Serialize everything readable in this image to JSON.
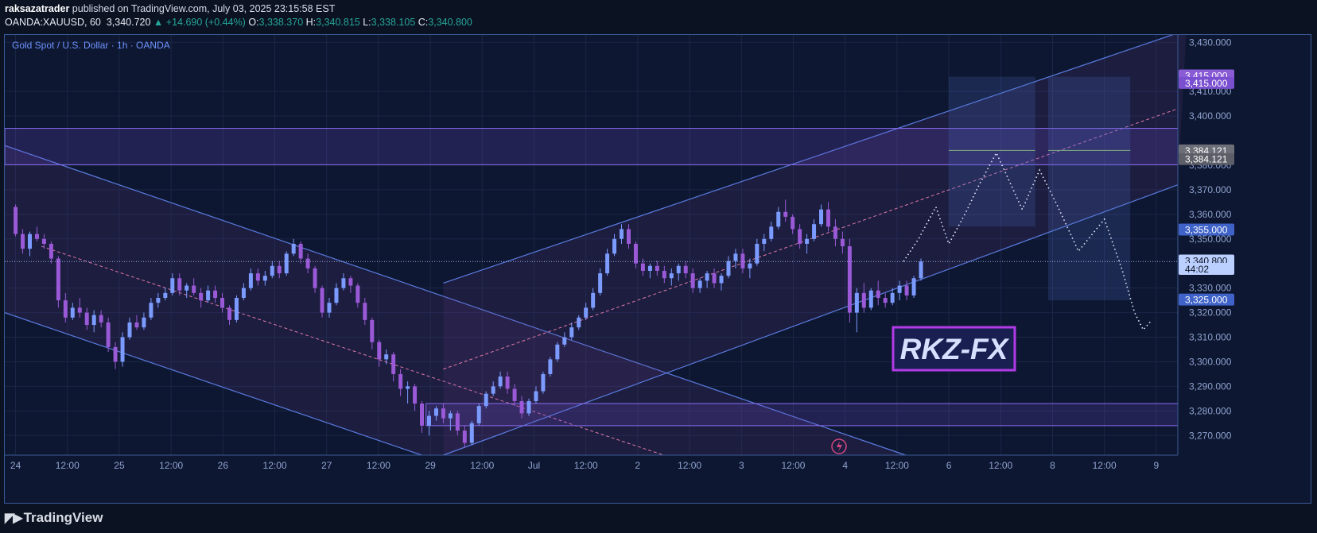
{
  "header": {
    "author": "raksazatrader",
    "published_text": "published on TradingView.com, July 03, 2025 23:15:58 EST",
    "symbol": "OANDA:XAUUSD, 60",
    "last": "3,340.720",
    "change": "▲ +14.690 (+0.44%)",
    "o_label": "O:",
    "o_value": "3,338.370",
    "h_label": "H:",
    "h_value": "3,340.815",
    "l_label": "L:",
    "l_value": "3,338.105",
    "c_label": "C:",
    "c_value": "3,340.800"
  },
  "footer": {
    "brand": "TradingView",
    "logo_icon": "tradingview-logo-icon"
  },
  "colors": {
    "bull": "#7b9bff",
    "bear": "#9a59d6",
    "bg": "#0e1731",
    "channel": "#5a7be0",
    "zone": "#6e4fc9",
    "accent": "#c23ef0"
  },
  "chart_data": {
    "type": "candlestick",
    "title": "Gold Spot / U.S. Dollar · 1h · OANDA",
    "ylim": [
      3262,
      3433
    ],
    "y_ticks": [
      "3,270.000",
      "3,280.000",
      "3,290.000",
      "3,300.000",
      "3,310.000",
      "3,320.000",
      "3,330.000",
      "3,350.000",
      "3,360.000",
      "3,370.000",
      "3,380.000",
      "3,400.000",
      "3,410.000",
      "3,430.000"
    ],
    "y_tick_values": [
      3270,
      3280,
      3290,
      3300,
      3310,
      3320,
      3330,
      3350,
      3360,
      3370,
      3380,
      3400,
      3410,
      3430
    ],
    "x_ticks": [
      "24",
      "12:00",
      "25",
      "12:00",
      "26",
      "12:00",
      "27",
      "12:00",
      "29",
      "12:00",
      "Jul",
      "12:00",
      "2",
      "12:00",
      "3",
      "12:00",
      "4",
      "12:00",
      "6",
      "12:00",
      "8",
      "12:00",
      "9"
    ],
    "x_tick_hours": [
      0,
      12,
      24,
      36,
      48,
      60,
      72,
      84,
      96,
      108,
      120,
      132,
      144,
      156,
      168,
      180,
      192,
      204,
      216,
      228,
      240,
      252,
      264
    ],
    "x_range_hours": [
      -2.5,
      269
    ],
    "price_labels": [
      {
        "text": "3,415.000",
        "value": 3416.5,
        "color": "#8a5cd6"
      },
      {
        "text": "3,415.000",
        "value": 3413.5,
        "color": "#7a4fd0"
      },
      {
        "text": "3,384.121",
        "value": 3386,
        "color": "#6d6f78"
      },
      {
        "text": "3,384.121",
        "value": 3382.5,
        "color": "#5d5f68"
      },
      {
        "text": "3,355.000",
        "value": 3353.8,
        "color": "#3f63c8"
      },
      {
        "text": "3,340.800",
        "value": 3341.2,
        "color": "#bcd0ff",
        "text_color": "#0b1222"
      },
      {
        "text": "44:02",
        "value": 3337.8,
        "color": "#bcd0ff",
        "text_color": "#0b1222"
      },
      {
        "text": "3,325.000",
        "value": 3325.3,
        "color": "#3f63c8"
      }
    ],
    "current_price": 3340.8,
    "candles": [
      [
        3363,
        3364,
        3351,
        3352
      ],
      [
        3352,
        3354,
        3344,
        3346
      ],
      [
        3346,
        3353,
        3343,
        3352
      ],
      [
        3352,
        3355,
        3349,
        3350
      ],
      [
        3350,
        3352,
        3346,
        3348
      ],
      [
        3348,
        3349,
        3340,
        3342
      ],
      [
        3342,
        3343,
        3322,
        3325
      ],
      [
        3325,
        3328,
        3316,
        3318
      ],
      [
        3318,
        3324,
        3317,
        3322
      ],
      [
        3322,
        3326,
        3318,
        3320
      ],
      [
        3320,
        3322,
        3313,
        3315
      ],
      [
        3315,
        3321,
        3312,
        3319
      ],
      [
        3319,
        3321,
        3314,
        3316
      ],
      [
        3316,
        3318,
        3304,
        3306
      ],
      [
        3306,
        3308,
        3297,
        3300
      ],
      [
        3300,
        3312,
        3298,
        3310
      ],
      [
        3310,
        3318,
        3309,
        3316
      ],
      [
        3316,
        3319,
        3313,
        3314
      ],
      [
        3314,
        3320,
        3313,
        3318
      ],
      [
        3318,
        3326,
        3317,
        3324
      ],
      [
        3324,
        3328,
        3322,
        3326
      ],
      [
        3326,
        3330,
        3325,
        3328
      ],
      [
        3328,
        3336,
        3327,
        3334
      ],
      [
        3334,
        3336,
        3327,
        3329
      ],
      [
        3329,
        3332,
        3326,
        3331
      ],
      [
        3331,
        3334,
        3327,
        3328
      ],
      [
        3328,
        3330,
        3322,
        3325
      ],
      [
        3325,
        3331,
        3324,
        3329
      ],
      [
        3329,
        3331,
        3324,
        3326
      ],
      [
        3326,
        3328,
        3320,
        3322
      ],
      [
        3322,
        3323,
        3315,
        3317
      ],
      [
        3317,
        3327,
        3316,
        3326
      ],
      [
        3326,
        3332,
        3325,
        3330
      ],
      [
        3330,
        3338,
        3329,
        3336
      ],
      [
        3336,
        3338,
        3331,
        3333
      ],
      [
        3333,
        3337,
        3331,
        3335
      ],
      [
        3335,
        3341,
        3334,
        3339
      ],
      [
        3339,
        3341,
        3334,
        3336
      ],
      [
        3336,
        3345,
        3335,
        3344
      ],
      [
        3344,
        3350,
        3343,
        3348
      ],
      [
        3348,
        3349,
        3340,
        3342
      ],
      [
        3342,
        3344,
        3336,
        3338
      ],
      [
        3338,
        3339,
        3328,
        3330
      ],
      [
        3330,
        3331,
        3318,
        3320
      ],
      [
        3320,
        3326,
        3318,
        3324
      ],
      [
        3324,
        3332,
        3323,
        3330
      ],
      [
        3330,
        3336,
        3329,
        3334
      ],
      [
        3334,
        3335,
        3328,
        3331
      ],
      [
        3331,
        3332,
        3322,
        3324
      ],
      [
        3324,
        3326,
        3315,
        3317
      ],
      [
        3317,
        3318,
        3305,
        3308
      ],
      [
        3308,
        3309,
        3298,
        3301
      ],
      [
        3301,
        3305,
        3299,
        3303
      ],
      [
        3303,
        3304,
        3292,
        3295
      ],
      [
        3295,
        3297,
        3286,
        3289
      ],
      [
        3289,
        3292,
        3283,
        3290
      ],
      [
        3290,
        3291,
        3280,
        3283
      ],
      [
        3283,
        3284,
        3271,
        3274
      ],
      [
        3274,
        3280,
        3270,
        3278
      ],
      [
        3278,
        3282,
        3276,
        3281
      ],
      [
        3281,
        3283,
        3275,
        3277
      ],
      [
        3277,
        3280,
        3272,
        3279
      ],
      [
        3279,
        3280,
        3270,
        3272
      ],
      [
        3272,
        3274,
        3265,
        3267
      ],
      [
        3267,
        3276,
        3266,
        3275
      ],
      [
        3275,
        3283,
        3274,
        3282
      ],
      [
        3282,
        3288,
        3281,
        3287
      ],
      [
        3287,
        3292,
        3286,
        3290
      ],
      [
        3290,
        3296,
        3289,
        3294
      ],
      [
        3294,
        3296,
        3287,
        3289
      ],
      [
        3289,
        3291,
        3282,
        3284
      ],
      [
        3284,
        3286,
        3277,
        3279
      ],
      [
        3279,
        3285,
        3278,
        3284
      ],
      [
        3284,
        3290,
        3283,
        3288
      ],
      [
        3288,
        3296,
        3287,
        3295
      ],
      [
        3295,
        3302,
        3294,
        3301
      ],
      [
        3301,
        3308,
        3300,
        3307
      ],
      [
        3307,
        3312,
        3306,
        3310
      ],
      [
        3310,
        3316,
        3309,
        3314
      ],
      [
        3314,
        3319,
        3313,
        3318
      ],
      [
        3318,
        3324,
        3317,
        3322
      ],
      [
        3322,
        3330,
        3321,
        3328
      ],
      [
        3328,
        3338,
        3327,
        3336
      ],
      [
        3336,
        3346,
        3335,
        3344
      ],
      [
        3344,
        3352,
        3343,
        3350
      ],
      [
        3350,
        3356,
        3348,
        3354
      ],
      [
        3354,
        3356,
        3346,
        3348
      ],
      [
        3348,
        3349,
        3338,
        3340
      ],
      [
        3340,
        3342,
        3335,
        3337
      ],
      [
        3337,
        3340,
        3334,
        3339
      ],
      [
        3339,
        3341,
        3335,
        3337
      ],
      [
        3337,
        3339,
        3332,
        3334
      ],
      [
        3334,
        3338,
        3331,
        3336
      ],
      [
        3336,
        3340,
        3333,
        3339
      ],
      [
        3339,
        3341,
        3334,
        3336
      ],
      [
        3336,
        3338,
        3328,
        3330
      ],
      [
        3330,
        3334,
        3328,
        3333
      ],
      [
        3333,
        3337,
        3330,
        3336
      ],
      [
        3336,
        3338,
        3330,
        3332
      ],
      [
        3332,
        3336,
        3329,
        3335
      ],
      [
        3335,
        3343,
        3334,
        3341
      ],
      [
        3341,
        3346,
        3338,
        3344
      ],
      [
        3344,
        3346,
        3336,
        3338
      ],
      [
        3338,
        3342,
        3334,
        3340
      ],
      [
        3340,
        3350,
        3339,
        3348
      ],
      [
        3348,
        3352,
        3345,
        3350
      ],
      [
        3350,
        3357,
        3349,
        3355
      ],
      [
        3355,
        3363,
        3354,
        3361
      ],
      [
        3361,
        3366,
        3357,
        3359
      ],
      [
        3359,
        3360,
        3352,
        3354
      ],
      [
        3354,
        3356,
        3346,
        3348
      ],
      [
        3348,
        3352,
        3344,
        3350
      ],
      [
        3350,
        3358,
        3349,
        3356
      ],
      [
        3356,
        3364,
        3355,
        3362
      ],
      [
        3362,
        3365,
        3353,
        3355
      ],
      [
        3355,
        3358,
        3347,
        3350
      ],
      [
        3350,
        3353,
        3344,
        3347
      ],
      [
        3347,
        3350,
        3316,
        3320
      ],
      [
        3320,
        3330,
        3312,
        3328
      ],
      [
        3328,
        3332,
        3320,
        3322
      ],
      [
        3322,
        3330,
        3321,
        3329
      ],
      [
        3329,
        3333,
        3323,
        3326
      ],
      [
        3326,
        3328,
        3322,
        3324
      ],
      [
        3324,
        3330,
        3323,
        3328
      ],
      [
        3328,
        3333,
        3325,
        3331
      ],
      [
        3331,
        3333,
        3325,
        3327
      ],
      [
        3327,
        3335,
        3326,
        3334
      ],
      [
        3334,
        3342,
        3333,
        3340.8
      ]
    ],
    "projection_path": [
      [
        205.5,
        3340.8
      ],
      [
        209,
        3350
      ],
      [
        213,
        3363
      ],
      [
        216,
        3348
      ],
      [
        220,
        3361
      ],
      [
        223,
        3372
      ],
      [
        227,
        3385
      ],
      [
        233,
        3362
      ],
      [
        237,
        3378
      ],
      [
        241,
        3364
      ],
      [
        246,
        3345
      ],
      [
        252,
        3358
      ],
      [
        256,
        3338
      ],
      [
        259,
        3320
      ],
      [
        261,
        3313
      ],
      [
        263,
        3317
      ]
    ],
    "zones": [
      {
        "name": "resistance-zone",
        "from": 3380.2,
        "to": 3395
      },
      {
        "name": "support-zone",
        "from": 3274,
        "to": 3283
      }
    ],
    "boxes": [
      {
        "name": "range-box-left",
        "t0": 216,
        "t1": 236,
        "from": 3355,
        "to": 3416
      },
      {
        "name": "range-box-right",
        "t0": 239,
        "t1": 258,
        "from": 3325,
        "to": 3416
      }
    ],
    "channels": [
      {
        "name": "descending-channel",
        "upper": [
          [
            -2.5,
            3388
          ],
          [
            206,
            3262
          ]
        ],
        "lower": [
          [
            -2.5,
            3320
          ],
          [
            94,
            3262
          ]
        ],
        "mid": [
          [
            6,
            3347
          ],
          [
            150,
            3262
          ]
        ]
      },
      {
        "name": "ascending-channel",
        "upper": [
          [
            99,
            3332
          ],
          [
            271,
            3435
          ]
        ],
        "lower": [
          [
            99,
            3262
          ],
          [
            269,
            3372
          ]
        ],
        "mid": [
          [
            99,
            3297
          ],
          [
            269,
            3403
          ]
        ]
      }
    ],
    "watermark": "RKZ-FX"
  }
}
